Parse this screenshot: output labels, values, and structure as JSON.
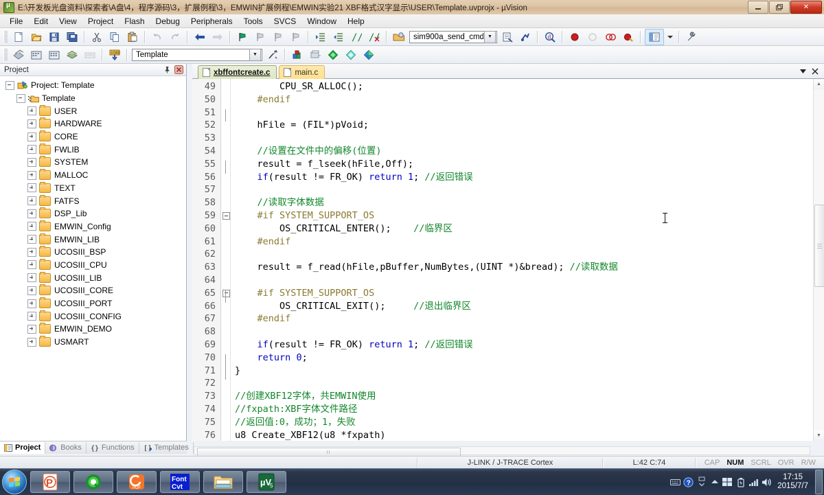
{
  "window": {
    "title": "E:\\开发板光盘资料\\探索者\\A盘\\4，程序源码\\3，扩展例程\\3，EMWIN扩展例程\\EMWIN实验21 XBF格式汉字显示\\USER\\Template.uvprojx - µVision",
    "app_icon": "uvision-icon",
    "minimize_label": "—",
    "maximize_label": "❐",
    "close_label": "✕"
  },
  "menubar": {
    "items": [
      "File",
      "Edit",
      "View",
      "Project",
      "Flash",
      "Debug",
      "Peripherals",
      "Tools",
      "SVCS",
      "Window",
      "Help"
    ]
  },
  "toolbar_main": {
    "target_value": "sim900a_send_cmd",
    "buttons": [
      "new-file-icon",
      "open-file-icon",
      "save-icon",
      "save-all-icon",
      "cut-icon",
      "copy-icon",
      "paste-icon",
      "undo-icon",
      "redo-icon",
      "back-icon",
      "forward-icon",
      "bookmark-toggle-icon",
      "bookmark-prev-icon",
      "bookmark-next-icon",
      "bookmark-clear-icon",
      "indent-icon",
      "outdent-icon",
      "comment-icon",
      "uncomment-icon",
      "target-options-icon",
      "debug-settings-icon",
      "find-in-files-icon",
      "breakpoint-icon",
      "breakpoint-disable-icon",
      "breakpoint-removeall-icon",
      "breakpoint-disableall-icon",
      "manage-windows-icon",
      "configure-icon"
    ]
  },
  "toolbar_build": {
    "project_value": "Template",
    "buttons": [
      "translate-icon",
      "build-icon",
      "rebuild-icon",
      "batch-build-icon",
      "stop-build-icon",
      "download-icon",
      "target-options-icon2",
      "manage-project-items-icon",
      "multi-project-icon",
      "green-diamond-icon",
      "cyan-diamond-icon",
      "pack-installer-icon"
    ]
  },
  "project_panel": {
    "title": "Project",
    "pin_icon": "pin-icon",
    "close_icon": "close-icon",
    "tree": [
      {
        "label": "Project: Template",
        "indent": 0,
        "toggle": "minus",
        "icon": "project-icon"
      },
      {
        "label": "Template",
        "indent": 1,
        "toggle": "minus",
        "icon": "target-icon"
      },
      {
        "label": "USER",
        "indent": 2,
        "toggle": "plus",
        "icon": "folder-icon"
      },
      {
        "label": "HARDWARE",
        "indent": 2,
        "toggle": "plus",
        "icon": "folder-icon"
      },
      {
        "label": "CORE",
        "indent": 2,
        "toggle": "plus",
        "icon": "folder-icon"
      },
      {
        "label": "FWLIB",
        "indent": 2,
        "toggle": "plus",
        "icon": "folder-icon"
      },
      {
        "label": "SYSTEM",
        "indent": 2,
        "toggle": "plus",
        "icon": "folder-icon"
      },
      {
        "label": "MALLOC",
        "indent": 2,
        "toggle": "plus",
        "icon": "folder-icon"
      },
      {
        "label": "TEXT",
        "indent": 2,
        "toggle": "plus",
        "icon": "folder-icon"
      },
      {
        "label": "FATFS",
        "indent": 2,
        "toggle": "plus",
        "icon": "folder-icon"
      },
      {
        "label": "DSP_Lib",
        "indent": 2,
        "toggle": "plus",
        "icon": "folder-icon"
      },
      {
        "label": "EMWIN_Config",
        "indent": 2,
        "toggle": "plus",
        "icon": "folder-icon"
      },
      {
        "label": "EMWIN_LIB",
        "indent": 2,
        "toggle": "plus",
        "icon": "folder-icon"
      },
      {
        "label": "UCOSIII_BSP",
        "indent": 2,
        "toggle": "plus",
        "icon": "folder-icon"
      },
      {
        "label": "UCOSIII_CPU",
        "indent": 2,
        "toggle": "plus",
        "icon": "folder-icon"
      },
      {
        "label": "UCOSIII_LIB",
        "indent": 2,
        "toggle": "plus",
        "icon": "folder-icon"
      },
      {
        "label": "UCOSIII_CORE",
        "indent": 2,
        "toggle": "plus",
        "icon": "folder-icon"
      },
      {
        "label": "UCOSIII_PORT",
        "indent": 2,
        "toggle": "plus",
        "icon": "folder-icon"
      },
      {
        "label": "UCOSIII_CONFIG",
        "indent": 2,
        "toggle": "plus",
        "icon": "folder-icon"
      },
      {
        "label": "EMWIN_DEMO",
        "indent": 2,
        "toggle": "plus",
        "icon": "folder-icon"
      },
      {
        "label": "USMART",
        "indent": 2,
        "toggle": "plus",
        "icon": "folder-icon"
      }
    ]
  },
  "panel_tabs": [
    {
      "label": "Project",
      "icon": "project-tab-icon",
      "active": true
    },
    {
      "label": "Books",
      "icon": "books-tab-icon",
      "active": false
    },
    {
      "label": "Functions",
      "icon": "functions-tab-icon",
      "active": false
    },
    {
      "label": "Templates",
      "icon": "templates-tab-icon",
      "active": false
    }
  ],
  "editor": {
    "tabs": [
      {
        "label": "xbffontcreate.c",
        "active": true
      },
      {
        "label": "main.c",
        "active": false
      }
    ],
    "tabbar_menu_icon": "chevron-down-icon",
    "tabbar_close_icon": "close-icon",
    "first_line": 49,
    "lines": [
      {
        "n": 49,
        "segs": [
          {
            "t": "        CPU_SR_ALLOC();",
            "c": ""
          }
        ]
      },
      {
        "n": 50,
        "segs": [
          {
            "t": "    #endif",
            "c": "pp"
          }
        ]
      },
      {
        "n": 51,
        "segs": [
          {
            "t": "",
            "c": ""
          }
        ]
      },
      {
        "n": 52,
        "segs": [
          {
            "t": "    hFile = (FIL*)pVoid;",
            "c": ""
          }
        ]
      },
      {
        "n": 53,
        "segs": [
          {
            "t": "",
            "c": ""
          }
        ]
      },
      {
        "n": 54,
        "segs": [
          {
            "t": "    //设置在文件中的偏移(位置)",
            "c": "cm"
          }
        ]
      },
      {
        "n": 55,
        "segs": [
          {
            "t": "    result = f_lseek(hFile,Off);",
            "c": ""
          }
        ]
      },
      {
        "n": 56,
        "segs": [
          {
            "t": "    ",
            "c": ""
          },
          {
            "t": "if",
            "c": "k"
          },
          {
            "t": "(result != FR_OK) ",
            "c": ""
          },
          {
            "t": "return",
            "c": "k"
          },
          {
            "t": " ",
            "c": ""
          },
          {
            "t": "1",
            "c": "num"
          },
          {
            "t": "; ",
            "c": ""
          },
          {
            "t": "//返回错误",
            "c": "cm"
          }
        ]
      },
      {
        "n": 57,
        "segs": [
          {
            "t": "",
            "c": ""
          }
        ]
      },
      {
        "n": 58,
        "segs": [
          {
            "t": "    //读取字体数据",
            "c": "cm"
          }
        ]
      },
      {
        "n": 59,
        "segs": [
          {
            "t": "    #if SYSTEM_SUPPORT_OS",
            "c": "pp"
          }
        ],
        "fold": true
      },
      {
        "n": 60,
        "segs": [
          {
            "t": "        OS_CRITICAL_ENTER();    ",
            "c": ""
          },
          {
            "t": "//临界区",
            "c": "cm"
          }
        ]
      },
      {
        "n": 61,
        "segs": [
          {
            "t": "    #endif",
            "c": "pp"
          }
        ]
      },
      {
        "n": 62,
        "segs": [
          {
            "t": "",
            "c": ""
          }
        ]
      },
      {
        "n": 63,
        "segs": [
          {
            "t": "    result = f_read(hFile,pBuffer,NumBytes,(UINT *)&bread); ",
            "c": ""
          },
          {
            "t": "//读取数据",
            "c": "cm"
          }
        ]
      },
      {
        "n": 64,
        "segs": [
          {
            "t": "",
            "c": ""
          }
        ]
      },
      {
        "n": 65,
        "segs": [
          {
            "t": "    #if SYSTEM_SUPPORT_OS",
            "c": "pp"
          }
        ],
        "fold": true
      },
      {
        "n": 66,
        "segs": [
          {
            "t": "        OS_CRITICAL_EXIT();     ",
            "c": ""
          },
          {
            "t": "//退出临界区",
            "c": "cm"
          }
        ]
      },
      {
        "n": 67,
        "segs": [
          {
            "t": "    #endif",
            "c": "pp"
          }
        ]
      },
      {
        "n": 68,
        "segs": [
          {
            "t": "",
            "c": ""
          }
        ]
      },
      {
        "n": 69,
        "segs": [
          {
            "t": "    ",
            "c": ""
          },
          {
            "t": "if",
            "c": "k"
          },
          {
            "t": "(result != FR_OK) ",
            "c": ""
          },
          {
            "t": "return",
            "c": "k"
          },
          {
            "t": " ",
            "c": ""
          },
          {
            "t": "1",
            "c": "num"
          },
          {
            "t": "; ",
            "c": ""
          },
          {
            "t": "//返回错误",
            "c": "cm"
          }
        ]
      },
      {
        "n": 70,
        "segs": [
          {
            "t": "    ",
            "c": ""
          },
          {
            "t": "return",
            "c": "k"
          },
          {
            "t": " ",
            "c": ""
          },
          {
            "t": "0",
            "c": "num"
          },
          {
            "t": ";",
            "c": ""
          }
        ]
      },
      {
        "n": 71,
        "segs": [
          {
            "t": "}",
            "c": ""
          }
        ]
      },
      {
        "n": 72,
        "segs": [
          {
            "t": "",
            "c": ""
          }
        ]
      },
      {
        "n": 73,
        "segs": [
          {
            "t": "//创建XBF12字体，共EMWIN使用",
            "c": "cm"
          }
        ]
      },
      {
        "n": 74,
        "segs": [
          {
            "t": "//fxpath:XBF字体文件路径",
            "c": "cm"
          }
        ]
      },
      {
        "n": 75,
        "segs": [
          {
            "t": "//返回值:0，成功；1，失败",
            "c": "cm"
          }
        ]
      },
      {
        "n": 76,
        "segs": [
          {
            "t": "u8 Create_XBF12(u8 *fxpath)",
            "c": ""
          }
        ]
      }
    ]
  },
  "statusbar": {
    "debugger": "J-LINK / J-TRACE Cortex",
    "position": "L:42 C:74",
    "indicators": [
      {
        "label": "CAP",
        "on": false
      },
      {
        "label": "NUM",
        "on": true
      },
      {
        "label": "SCRL",
        "on": false
      },
      {
        "label": "OVR",
        "on": false
      },
      {
        "label": "R/W",
        "on": false
      }
    ]
  },
  "taskbar": {
    "start_icon": "windows-start-orb",
    "tasks": [
      {
        "name": "powerpoint-taskbar-icon",
        "label": "P"
      },
      {
        "name": "qq-browser-taskbar-icon",
        "label": "Q"
      },
      {
        "name": "pdf-reader-taskbar-icon",
        "label": "G"
      },
      {
        "name": "font-cvt-taskbar-icon",
        "label": "Font\nCvt"
      },
      {
        "name": "folder-taskbar-icon",
        "label": ""
      },
      {
        "name": "uvision-taskbar-icon",
        "label": "µV5"
      }
    ],
    "tray": [
      "keyboard-layout-icon",
      "help-icon",
      "show-hidden-icons-icon",
      "network-icon",
      "battery-icon",
      "volume-icon"
    ],
    "clock_time": "17:15",
    "clock_date": "2015/7/7"
  },
  "colors": {
    "title_bg": "#dcc3a2",
    "accent_tab_active": "#e3ecd0",
    "accent_tab_inactive": "#ffdf8e",
    "comment_green": "#12872b",
    "keyword_blue": "#0000c0",
    "preproc_olive": "#8a7a30",
    "taskbar_bg": "#223046"
  }
}
